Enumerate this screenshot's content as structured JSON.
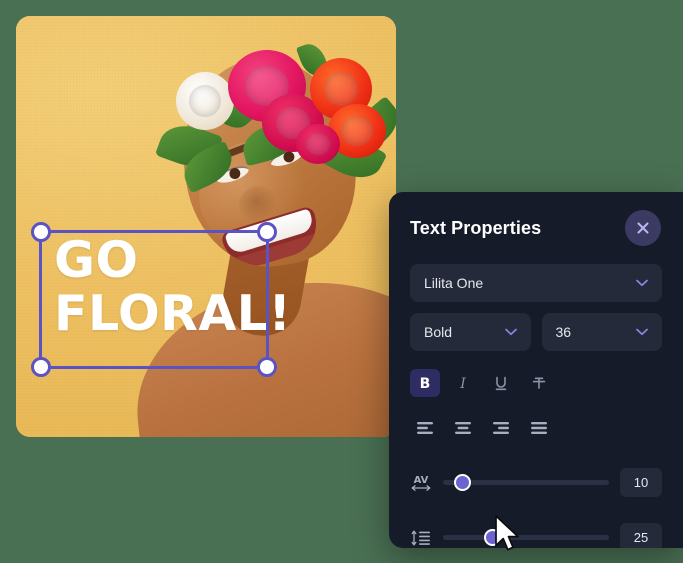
{
  "canvas": {
    "design_text_line1": "GO",
    "design_text_line2": "FLORAL!",
    "photo_description": "woman-with-flower-crown",
    "selection": {
      "handles": [
        "top-left",
        "top-right",
        "bottom-left",
        "bottom-right"
      ],
      "frame_color": "#5b52c4",
      "handle_fill": "#ffffff"
    }
  },
  "panel": {
    "title": "Text Properties",
    "close_label": "×",
    "bg_color": "#161b29",
    "accent_color": "#6c63d1",
    "font_field": {
      "value": "Lilita One",
      "chevron": "chevron-down-icon"
    },
    "weight_field": {
      "value": "Bold",
      "chevron": "chevron-down-icon"
    },
    "size_field": {
      "value": "36",
      "chevron": "chevron-down-icon"
    },
    "style_buttons": [
      {
        "name": "bold",
        "glyph": "B",
        "active": true
      },
      {
        "name": "italic",
        "glyph": "I",
        "active": false
      },
      {
        "name": "underline",
        "glyph": "U",
        "active": false
      },
      {
        "name": "strikethrough",
        "glyph": "T",
        "active": false
      }
    ],
    "align_buttons": [
      {
        "name": "align-left",
        "active": false
      },
      {
        "name": "align-center",
        "active": false
      },
      {
        "name": "align-right",
        "active": false
      },
      {
        "name": "align-justify",
        "active": false
      }
    ],
    "sliders": [
      {
        "name": "letter-spacing",
        "icon": "letter-spacing-icon",
        "icon_label": "AV",
        "value": "10",
        "percent": 12
      },
      {
        "name": "line-height",
        "icon": "line-height-icon",
        "value": "25",
        "percent": 30
      }
    ]
  },
  "cursor": {
    "type": "arrow-pointer"
  }
}
